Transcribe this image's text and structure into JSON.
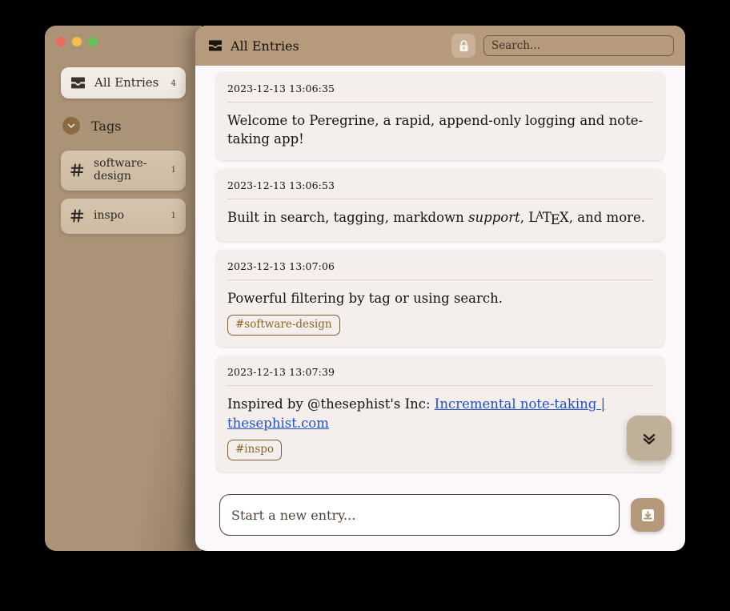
{
  "window": {
    "traffic_lights": [
      {
        "name": "close",
        "color": "#ec6a5e"
      },
      {
        "name": "minimize",
        "color": "#f5bf4f"
      },
      {
        "name": "zoom",
        "color": "#61c454"
      }
    ]
  },
  "sidebar": {
    "all_entries": {
      "label": "All Entries",
      "count": "4",
      "icon": "inbox-icon"
    },
    "tags_section": {
      "label": "Tags",
      "toggle_icon": "chevron-down-icon"
    },
    "tags": [
      {
        "label": "software-design",
        "count": "1",
        "icon": "hash-icon"
      },
      {
        "label": "inspo",
        "count": "1",
        "icon": "hash-icon"
      }
    ]
  },
  "topbar": {
    "title": "All Entries",
    "title_icon": "inbox-icon",
    "lock_button": {
      "icon": "lock-icon",
      "label": "Lock"
    },
    "search": {
      "placeholder": "Search...",
      "value": ""
    }
  },
  "entries": [
    {
      "time": "2023-12-13 13:06:35",
      "text": "Welcome to Peregrine, a rapid, append-only logging and note-taking app!",
      "tags": []
    },
    {
      "time": "2023-12-13 13:06:53",
      "text_before_italic": "Built in search, tagging, markdown ",
      "italic": "support",
      "text_after_italic": ", ",
      "latex": {
        "l": "L",
        "a": "A",
        "t": "T",
        "e": "E",
        "x": "X"
      },
      "text_end": ", and more.",
      "tags": []
    },
    {
      "time": "2023-12-13 13:07:06",
      "text": "Powerful filtering by tag or using search.",
      "tags": [
        "#software-design"
      ]
    },
    {
      "time": "2023-12-13 13:07:39",
      "text_before_link": "Inspired by @thesephist's Inc: ",
      "link_text": "Incremental note-taking | thesephist.com",
      "tags": [
        "#inspo"
      ]
    }
  ],
  "scroll_button": {
    "icon": "double-chevron-down-icon",
    "label": "Scroll to bottom"
  },
  "composer": {
    "placeholder": "Start a new entry...",
    "value": "",
    "submit": {
      "icon": "save-to-tray-icon",
      "label": "Submit entry"
    }
  },
  "colors": {
    "sidebar_bg": "#ab9378",
    "topbar_bg": "#b69a7c",
    "panel_bg": "#fdf9fb",
    "entry_bg": "#f4efec",
    "tag_text": "#8a6523",
    "link": "#2250c8",
    "accent_button": "#b5997a"
  }
}
